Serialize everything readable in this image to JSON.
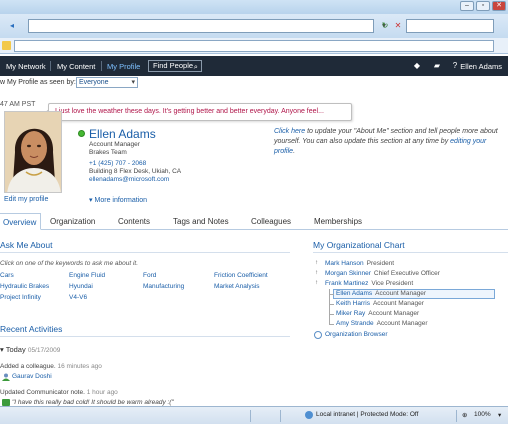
{
  "browser": {
    "back": "◂",
    "stop": "✕",
    "refresh": "↻",
    "zoom": "100%",
    "status_zone": "Local intranet | Protected Mode: Off"
  },
  "topnav": {
    "items": [
      "My Network",
      "My Content",
      "My Profile"
    ],
    "find_people": "Find People",
    "user": "Ellen Adams",
    "icons": [
      "tag-icon",
      "note-icon",
      "help-icon"
    ]
  },
  "seen_by": {
    "label": "w My Profile as seen by:",
    "value": "Everyone"
  },
  "status": {
    "time": "47 AM PST",
    "message": "I just love the weather these days. It's getting better and better everyday. Anyone feel..."
  },
  "profile": {
    "name": "Ellen Adams",
    "title": "Account Manager",
    "team": "Brakes Team",
    "phone": "+1 (425) 707 - 2068",
    "address": "Building 8 Flex Desk, Ukiah, CA",
    "email": "ellenadams@microsoft.com",
    "more_info": "More information",
    "edit_profile": "Edit my profile",
    "about_prefix": "Click here",
    "about_middle": " to update your \"About Me\" section and tell people more about yourself. You can also update this section at any time by ",
    "about_link": "editing your profile",
    "about_suffix": "."
  },
  "tabs": [
    "Overview",
    "Organization",
    "Contents",
    "Tags and Notes",
    "Colleagues",
    "Memberships"
  ],
  "ask_me_about": {
    "heading": "Ask Me About",
    "hint": "Click on one of the keywords to ask me about it.",
    "keywords": [
      [
        "Cars",
        "Engine Fluid",
        "Ford",
        "Friction Coefficient"
      ],
      [
        "Hydraulic Brakes",
        "Hyundai",
        "Manufacturing",
        "Market Analysis"
      ],
      [
        "Project Infinity",
        "V4-V6",
        "",
        ""
      ]
    ]
  },
  "recent": {
    "heading": "Recent Activities",
    "today": "Today",
    "today_date": "05/17/2009",
    "activities": [
      {
        "text": "Added a colleague.",
        "ago": "16 minutes ago",
        "link": "Gaurav Doshi"
      },
      {
        "text": "Updated Communicator note.",
        "ago": "1 hour ago",
        "link": "\"I have this really bad cold! It should be warm already :(\""
      }
    ]
  },
  "org_chart": {
    "heading": "My Organizational Chart",
    "managers": [
      {
        "name": "Mark Hanson",
        "title": "President"
      },
      {
        "name": "Morgan Skinner",
        "title": "Chief Executive Officer"
      },
      {
        "name": "Frank Martinez",
        "title": "Vice President"
      }
    ],
    "peers": [
      {
        "name": "Ellen Adams",
        "title": "Account Manager"
      },
      {
        "name": "Keith Harris",
        "title": "Account Manager"
      },
      {
        "name": "Miker Ray",
        "title": "Account Manager"
      },
      {
        "name": "Amy Strande",
        "title": "Account Manager"
      }
    ],
    "browser": "Organization Browser"
  },
  "colors": {
    "nav_bg": "#1f2a38",
    "link": "#1a5ea8",
    "status_text": "#b0164a",
    "presence": "#46b833"
  }
}
